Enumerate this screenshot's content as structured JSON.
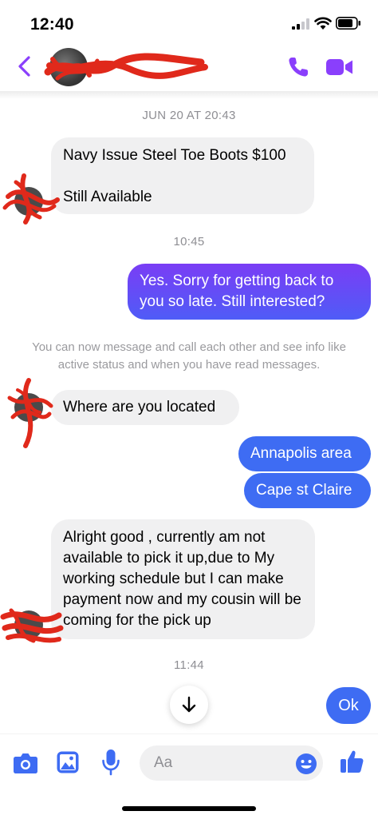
{
  "status_bar": {
    "time": "12:40"
  },
  "header": {
    "contact_name_redacted": true,
    "back_icon": "chevron-left-icon",
    "call_icon": "phone-icon",
    "video_icon": "video-camera-icon",
    "accent_color": "#8a3ffc"
  },
  "messages": {
    "timestamp_1": "JUN 20 AT 20:43",
    "msg_1": "Navy Issue Steel Toe Boots $100\n\nStill Available",
    "timestamp_2": "10:45",
    "msg_2": "Yes. Sorry for getting back to you so late. Still interested?",
    "info_notice": "You can now message and call each other and see info like active status and when you have read messages.",
    "msg_3": "Where are you located",
    "msg_4": "Annapolis area",
    "msg_5": "Cape st Claire",
    "msg_6": "Alright good , currently am not available to pick it up,due to My working schedule but I can make payment now and my cousin will be coming for the pick up",
    "timestamp_3": "11:44",
    "msg_7": "Ok"
  },
  "composer": {
    "placeholder": "Aa",
    "icons": [
      "camera-icon",
      "image-icon",
      "microphone-icon",
      "emoji-icon",
      "thumbs-up-icon"
    ]
  },
  "colors": {
    "outgoing_gradient_top": "#7a3df5",
    "outgoing_gradient_bottom": "#4f5cf7",
    "outgoing_blue": "#3e6cf3",
    "incoming": "#f0f0f1",
    "redaction": "#e0291b"
  }
}
